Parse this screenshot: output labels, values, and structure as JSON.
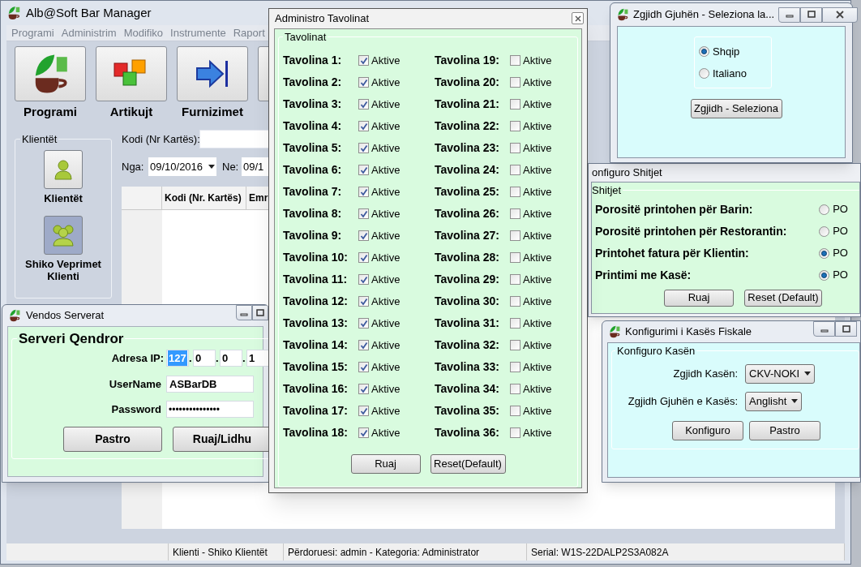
{
  "main_window": {
    "title": "Alb@Soft Bar Manager",
    "menu": [
      "Programi",
      "Administrim",
      "Modifiko",
      "Instrumente",
      "Raport"
    ],
    "toolbar": [
      {
        "kind": "logo",
        "label": "Programi"
      },
      {
        "kind": "cubes",
        "label": "Artikujt"
      },
      {
        "kind": "arrow",
        "label": "Furnizimet"
      }
    ],
    "clients_group": {
      "title": "Klientët",
      "buttons": [
        {
          "kind": "person",
          "label": "Klientët",
          "selected": false
        },
        {
          "kind": "people",
          "label": "Shiko Veprimet Klienti",
          "selected": true
        }
      ]
    },
    "filter": {
      "code_label": "Kodi (Nr Kartës):",
      "from_label": "Nga:",
      "from_value": "09/10/2016",
      "to_label": "Ne:",
      "to_value": "09/1"
    },
    "table": {
      "columns": [
        "Kodi (Nr. Kartës)",
        "Emr"
      ]
    },
    "status_bar": [
      "Klienti - Shiko Klientët",
      "Përdoruesi: admin - Kategoria: Administrator",
      "Serial: W1S-22DALP2S3A082A"
    ]
  },
  "server_window": {
    "title": "Vendos Serverat",
    "group": "Serveri Qendror",
    "ip_label": "Adresa IP:",
    "ip": [
      {
        "value": "127",
        "highlighted": true
      },
      {
        "separator": ".",
        "value": "0",
        "highlighted": false
      },
      {
        "separator": ".",
        "value": "0",
        "highlighted": false
      },
      {
        "separator": ".",
        "value": "1",
        "highlighted": false
      }
    ],
    "username_label": "UserName",
    "username": "ASBarDB",
    "password_label": "Password",
    "password": "•••••••••••••••",
    "buttons": [
      "Pastro",
      "Ruaj/Lidhu"
    ]
  },
  "tables_window": {
    "title": "Administro Tavolinat",
    "group": "Tavolinat",
    "tables": [
      {
        "label": "Tavolina 1:",
        "option": "Aktive",
        "checked": true
      },
      {
        "label": "Tavolina 2:",
        "option": "Aktive",
        "checked": true
      },
      {
        "label": "Tavolina 3:",
        "option": "Aktive",
        "checked": true
      },
      {
        "label": "Tavolina 4:",
        "option": "Aktive",
        "checked": true
      },
      {
        "label": "Tavolina 5:",
        "option": "Aktive",
        "checked": true
      },
      {
        "label": "Tavolina 6:",
        "option": "Aktive",
        "checked": true
      },
      {
        "label": "Tavolina 7:",
        "option": "Aktive",
        "checked": true
      },
      {
        "label": "Tavolina 8:",
        "option": "Aktive",
        "checked": true
      },
      {
        "label": "Tavolina 9:",
        "option": "Aktive",
        "checked": true
      },
      {
        "label": "Tavolina 10:",
        "option": "Aktive",
        "checked": true
      },
      {
        "label": "Tavolina 11:",
        "option": "Aktive",
        "checked": true
      },
      {
        "label": "Tavolina 12:",
        "option": "Aktive",
        "checked": true
      },
      {
        "label": "Tavolina 13:",
        "option": "Aktive",
        "checked": true
      },
      {
        "label": "Tavolina 14:",
        "option": "Aktive",
        "checked": true
      },
      {
        "label": "Tavolina 15:",
        "option": "Aktive",
        "checked": true
      },
      {
        "label": "Tavolina 16:",
        "option": "Aktive",
        "checked": true
      },
      {
        "label": "Tavolina 17:",
        "option": "Aktive",
        "checked": true
      },
      {
        "label": "Tavolina 18:",
        "option": "Aktive",
        "checked": true
      },
      {
        "label": "Tavolina 19:",
        "option": "Aktive",
        "checked": false
      },
      {
        "label": "Tavolina 20:",
        "option": "Aktive",
        "checked": false
      },
      {
        "label": "Tavolina 21:",
        "option": "Aktive",
        "checked": false
      },
      {
        "label": "Tavolina 22:",
        "option": "Aktive",
        "checked": false
      },
      {
        "label": "Tavolina 23:",
        "option": "Aktive",
        "checked": false
      },
      {
        "label": "Tavolina 24:",
        "option": "Aktive",
        "checked": false
      },
      {
        "label": "Tavolina 25:",
        "option": "Aktive",
        "checked": false
      },
      {
        "label": "Tavolina 26:",
        "option": "Aktive",
        "checked": false
      },
      {
        "label": "Tavolina 27:",
        "option": "Aktive",
        "checked": false
      },
      {
        "label": "Tavolina 28:",
        "option": "Aktive",
        "checked": false
      },
      {
        "label": "Tavolina 29:",
        "option": "Aktive",
        "checked": false
      },
      {
        "label": "Tavolina 30:",
        "option": "Aktive",
        "checked": false
      },
      {
        "label": "Tavolina 31:",
        "option": "Aktive",
        "checked": false
      },
      {
        "label": "Tavolina 32:",
        "option": "Aktive",
        "checked": false
      },
      {
        "label": "Tavolina 33:",
        "option": "Aktive",
        "checked": false
      },
      {
        "label": "Tavolina 34:",
        "option": "Aktive",
        "checked": false
      },
      {
        "label": "Tavolina 35:",
        "option": "Aktive",
        "checked": false
      },
      {
        "label": "Tavolina 36:",
        "option": "Aktive",
        "checked": false
      }
    ],
    "buttons": [
      "Ruaj",
      "Reset(Default)"
    ]
  },
  "language_window": {
    "title": "Zgjidh Gjuhën - Seleziona la...",
    "options": [
      {
        "label": "Shqip",
        "selected": true
      },
      {
        "label": "Italiano",
        "selected": false
      }
    ],
    "button": "Zgjidh - Seleziona"
  },
  "sales_window": {
    "title": "onfiguro Shitjet",
    "group": "Shitjet",
    "settings": [
      {
        "label": "Porositë printohen për Barin:",
        "option": "PO",
        "selected": false
      },
      {
        "label": "Porositë printohen për Restorantin:",
        "option": "PO",
        "selected": false
      },
      {
        "label": "Printohet fatura për Klientin:",
        "option": "PO",
        "selected": true
      },
      {
        "label": "Printimi me Kasë:",
        "option": "PO",
        "selected": true
      }
    ],
    "buttons": [
      "Ruaj",
      "Reset (Default)"
    ]
  },
  "fiscal_window": {
    "title": "Konfigurimi i Kasës Fiskale",
    "group": "Konfiguro Kasën",
    "fields": [
      {
        "label": "Zgjidh Kasën:",
        "value": "CKV-NOKI"
      },
      {
        "label": "Zgjidh Gjuhën e Kasës:",
        "value": "Anglisht"
      }
    ],
    "buttons": [
      "Konfiguro",
      "Pastro"
    ]
  }
}
